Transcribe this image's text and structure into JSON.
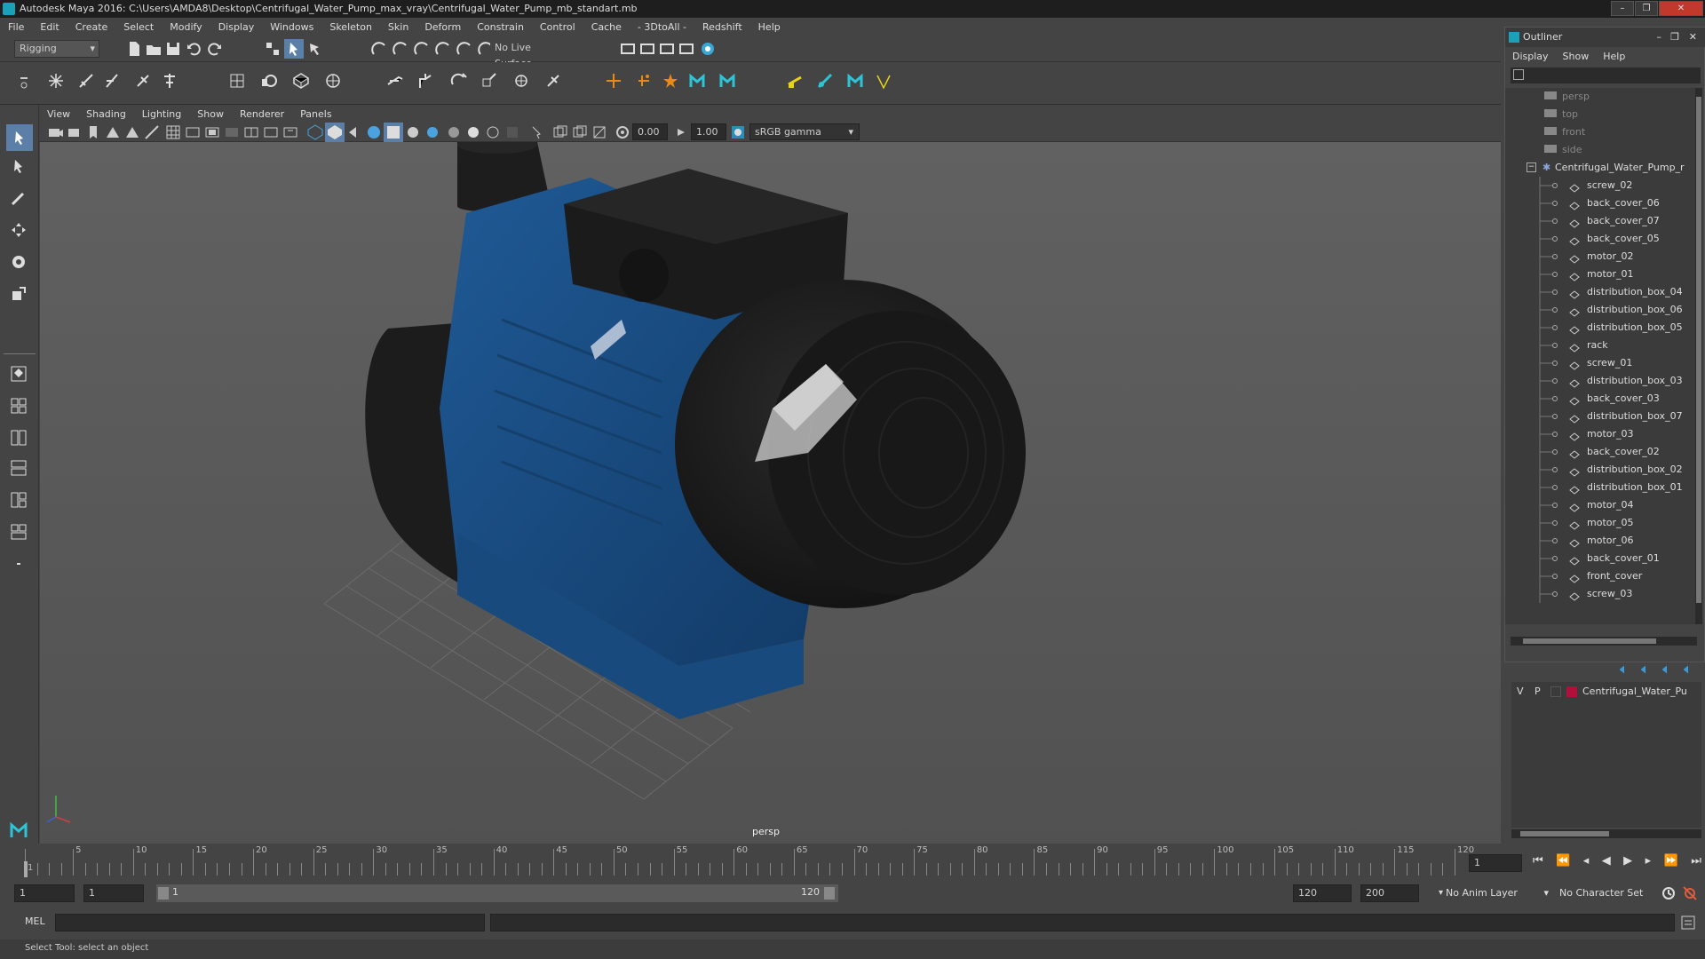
{
  "window": {
    "title": "Autodesk Maya 2016: C:\\Users\\AMDA8\\Desktop\\Centrifugal_Water_Pump_max_vray\\Centrifugal_Water_Pump_mb_standart.mb"
  },
  "menubar": {
    "items": [
      "File",
      "Edit",
      "Create",
      "Select",
      "Modify",
      "Display",
      "Windows",
      "Skeleton",
      "Skin",
      "Deform",
      "Constrain",
      "Control",
      "Cache",
      "- 3DtoAll -",
      "Redshift",
      "Help"
    ]
  },
  "statusline": {
    "mode": "Rigging",
    "live_surface": "No Live Surface"
  },
  "viewport": {
    "menu": [
      "View",
      "Shading",
      "Lighting",
      "Show",
      "Renderer",
      "Panels"
    ],
    "exposure": "0.00",
    "gamma": "1.00",
    "color_space": "sRGB gamma",
    "camera_label": "persp"
  },
  "outliner": {
    "title": "Outliner",
    "menu": [
      "Display",
      "Show",
      "Help"
    ],
    "cameras": [
      "persp",
      "top",
      "front",
      "side"
    ],
    "root": "Centrifugal_Water_Pump_r",
    "items": [
      "screw_02",
      "back_cover_06",
      "back_cover_07",
      "back_cover_05",
      "motor_02",
      "motor_01",
      "distribution_box_04",
      "distribution_box_06",
      "distribution_box_05",
      "rack",
      "screw_01",
      "distribution_box_03",
      "back_cover_03",
      "distribution_box_07",
      "motor_03",
      "back_cover_02",
      "distribution_box_02",
      "distribution_box_01",
      "motor_04",
      "motor_05",
      "motor_06",
      "back_cover_01",
      "front_cover",
      "screw_03"
    ]
  },
  "layers": {
    "visible": "V",
    "playback": "P",
    "layer_name": "Centrifugal_Water_Pu",
    "layer_color": "#b0103a"
  },
  "timeline": {
    "ticks": [
      "1",
      "5",
      "10",
      "15",
      "20",
      "25",
      "30",
      "35",
      "40",
      "45",
      "50",
      "55",
      "60",
      "65",
      "70",
      "75",
      "80",
      "85",
      "90",
      "95",
      "100",
      "105",
      "110",
      "115",
      "120"
    ],
    "current_frame": "1"
  },
  "range": {
    "start": "1",
    "playback_start": "1",
    "slider_start": "1",
    "slider_end": "120",
    "playback_end": "120",
    "end": "200",
    "anim_layer": "No Anim Layer",
    "character_set": "No Character Set"
  },
  "cmdline": {
    "label": "MEL"
  },
  "helpline": {
    "text": "Select Tool: select an object"
  },
  "colors": {
    "pump_blue": "#1d4f85",
    "pump_dark": "#1a1a1a",
    "viewport_bg": "#5a5a5a"
  }
}
